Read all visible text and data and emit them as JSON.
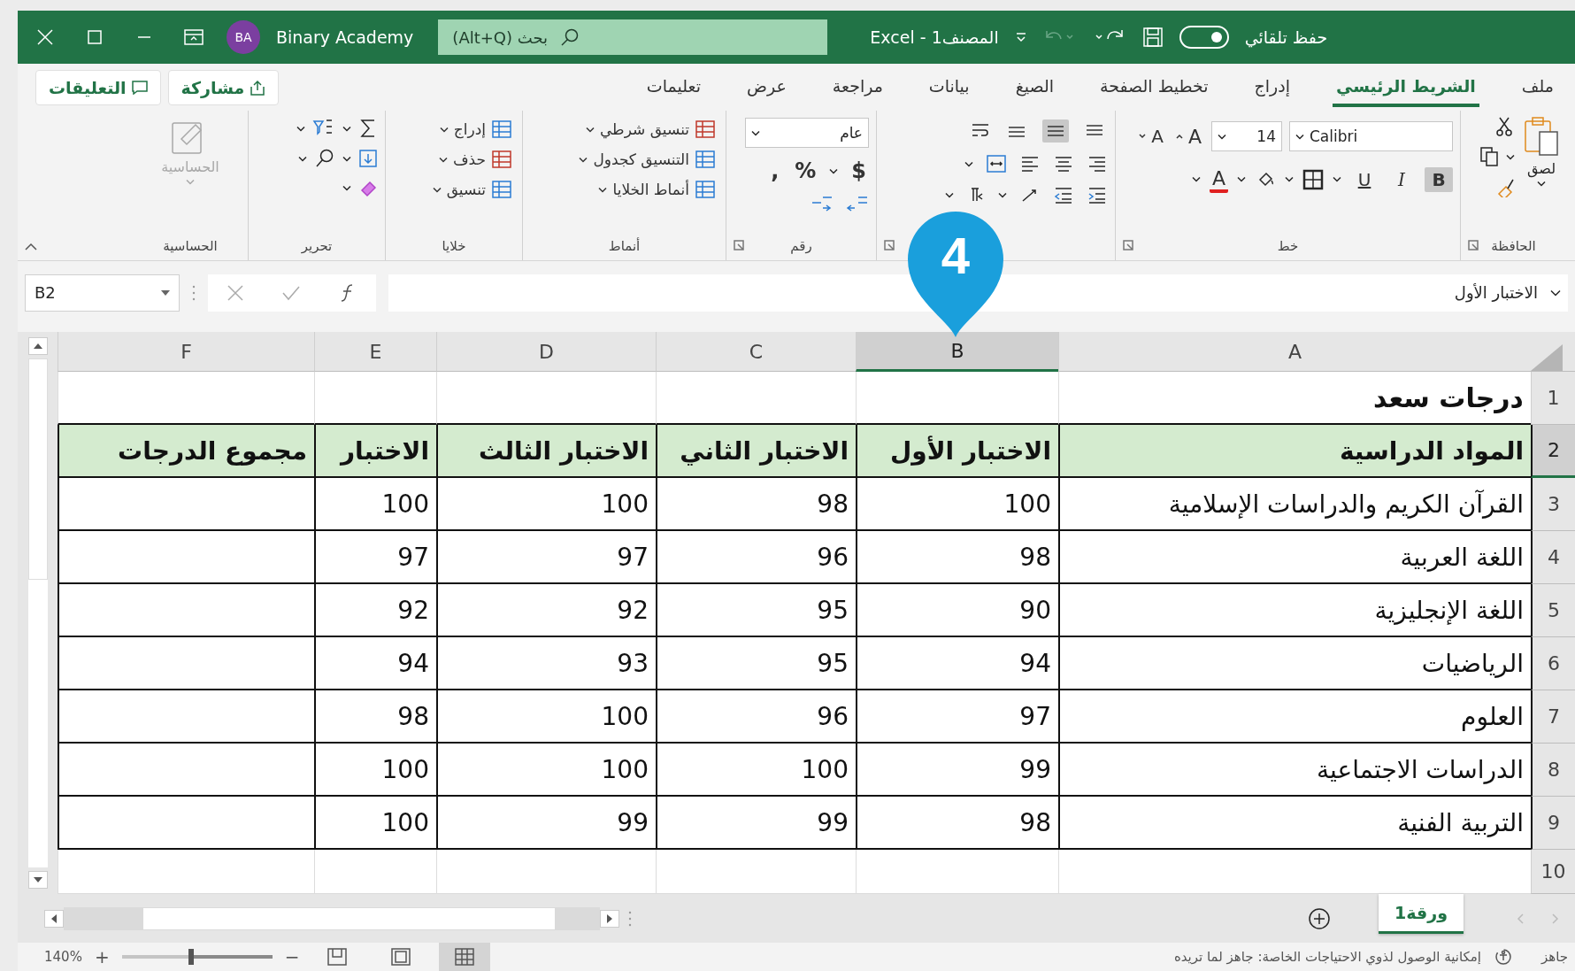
{
  "title_bar": {
    "autosave_label": "حفظ تلقائي",
    "autosave_on": true,
    "document_title": "المصنف1 - Excel",
    "search_placeholder": "بحث (Alt+Q)",
    "user_initials": "BA",
    "user_name": "Binary Academy"
  },
  "tabs": [
    {
      "label": "ملف",
      "selected": false
    },
    {
      "label": "الشريط الرئيسي",
      "selected": true
    },
    {
      "label": "إدراج",
      "selected": false
    },
    {
      "label": "تخطيط الصفحة",
      "selected": false
    },
    {
      "label": "الصيغ",
      "selected": false
    },
    {
      "label": "بيانات",
      "selected": false
    },
    {
      "label": "مراجعة",
      "selected": false
    },
    {
      "label": "عرض",
      "selected": false
    },
    {
      "label": "تعليمات",
      "selected": false
    }
  ],
  "share_button": "مشاركة",
  "comments_button": "التعليقات",
  "ribbon": {
    "clipboard": {
      "paste_label": "لصق",
      "group_label": "الحافظة"
    },
    "font": {
      "font_name": "Calibri",
      "font_size": "14",
      "grow_label": "A",
      "shrink_label": "A",
      "styles": [
        {
          "label": "B",
          "selected": true
        },
        {
          "label": "I",
          "selected": false
        },
        {
          "label": "U",
          "selected": false
        }
      ],
      "font_color_label": "A",
      "group_label": "خط"
    },
    "alignment": {
      "vertical": [
        {
          "selected": false
        },
        {
          "selected": true
        },
        {
          "selected": false
        }
      ]
    },
    "number": {
      "format": "عام",
      "symbols": [
        "$",
        "%",
        ","
      ],
      "group_label": "رقم"
    },
    "styles": {
      "items": [
        "تنسيق شرطي",
        "التنسيق كجدول",
        "أنماط الخلايا"
      ],
      "group_label": "أنماط"
    },
    "cells": {
      "items": [
        "إدراج",
        "حذف",
        "تنسيق"
      ],
      "group_label": "خلايا"
    },
    "editing": {
      "group_label": "تحرير"
    },
    "sensitivity": {
      "button_label": "الحساسية",
      "disabled": true,
      "group_label": "الحساسية"
    }
  },
  "callout": {
    "number": "4"
  },
  "formula_bar": {
    "name_box": "B2",
    "formula": "الاختبار الأول"
  },
  "sheet": {
    "columns": [
      {
        "label": "A",
        "selected": false
      },
      {
        "label": "B",
        "selected": true
      },
      {
        "label": "C",
        "selected": false
      },
      {
        "label": "D",
        "selected": false
      },
      {
        "label": "E",
        "selected": false
      },
      {
        "label": "F",
        "selected": false
      }
    ],
    "rows": [
      {
        "header": "1",
        "selected": false,
        "kind": "title",
        "cells": [
          "درجات سعد"
        ]
      },
      {
        "header": "2",
        "selected": true,
        "kind": "header",
        "cells": [
          "المواد الدراسية",
          "الاختبار الأول",
          "الاختبار الثاني",
          "الاختبار الثالث",
          "الاختبار",
          "مجموع الدرجات"
        ]
      },
      {
        "header": "3",
        "selected": false,
        "kind": "data",
        "cells": [
          "القرآن الكريم والدراسات الإسلامية",
          "100",
          "98",
          "100",
          "100"
        ]
      },
      {
        "header": "4",
        "selected": false,
        "kind": "data",
        "cells": [
          "اللغة العربية",
          "98",
          "96",
          "97",
          "97"
        ]
      },
      {
        "header": "5",
        "selected": false,
        "kind": "data",
        "cells": [
          "اللغة الإنجليزية",
          "90",
          "95",
          "92",
          "92"
        ]
      },
      {
        "header": "6",
        "selected": false,
        "kind": "data",
        "cells": [
          "الرياضيات",
          "94",
          "95",
          "93",
          "94"
        ]
      },
      {
        "header": "7",
        "selected": false,
        "kind": "data",
        "cells": [
          "العلوم",
          "97",
          "96",
          "100",
          "98"
        ]
      },
      {
        "header": "8",
        "selected": false,
        "kind": "data",
        "cells": [
          "الدراسات الاجتماعية",
          "99",
          "100",
          "100",
          "100"
        ]
      },
      {
        "header": "9",
        "selected": false,
        "kind": "data",
        "cells": [
          "التربية الفنية",
          "98",
          "99",
          "99",
          "100"
        ]
      },
      {
        "header": "10",
        "selected": false,
        "kind": "empty"
      }
    ]
  },
  "sheet_tabs": [
    {
      "label": "ورقة1",
      "selected": true
    }
  ],
  "status_bar": {
    "status": "جاهز",
    "accessibility": "إمكانية الوصول لذوي الاحتياجات الخاصة: جاهز لما تريده",
    "zoom": "140%",
    "zoom_in": "+",
    "zoom_out": "−",
    "zoom_slider": {
      "level": 0.54
    },
    "views": [
      {
        "kind": "normal",
        "selected": true
      },
      {
        "kind": "page_layout",
        "selected": false
      },
      {
        "kind": "page_break",
        "selected": false
      }
    ]
  }
}
